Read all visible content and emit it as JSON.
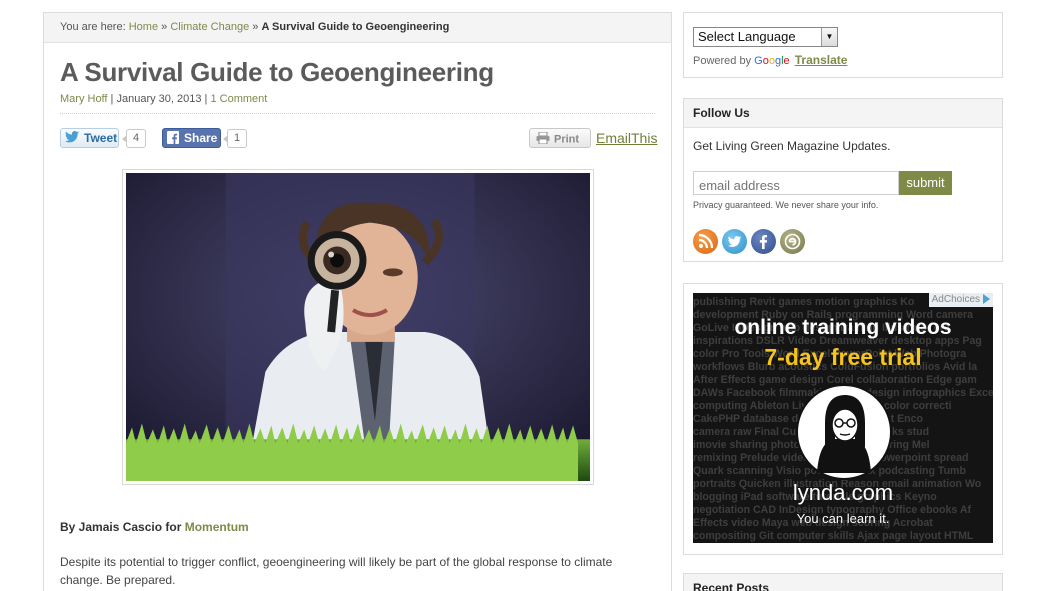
{
  "breadcrumb": {
    "prefix": "You are here:",
    "home": "Home",
    "category": "Climate Change",
    "current": "A Survival Guide to Geoengineering",
    "separator": "»"
  },
  "article": {
    "title": "A Survival Guide to Geoengineering",
    "author": "Mary Hoff",
    "date": "January 30, 2013",
    "comments": "1 Comment",
    "byline_prefix": "By Jamais Cascio for",
    "byline_source": "Momentum",
    "paragraph": "Despite its potential to trigger conflict, geoengineering will likely be part of the global response to climate change. Be prepared."
  },
  "share": {
    "tweet_label": "Tweet",
    "tweet_count": "4",
    "share_label": "Share",
    "share_count": "1",
    "print_label": "Print",
    "email_label": "EmailThis"
  },
  "sidebar": {
    "language": {
      "select_value": "Select Language",
      "powered_by": "Powered by",
      "google": [
        "G",
        "o",
        "o",
        "g",
        "l",
        "e"
      ],
      "translate": "Translate"
    },
    "follow": {
      "heading": "Follow Us",
      "description": "Get Living Green Magazine Updates.",
      "email_placeholder": "email address",
      "submit_label": "submit",
      "privacy": "Privacy guaranteed. We never share your info.",
      "social_icons": [
        "rss-icon",
        "twitter-icon",
        "facebook-icon",
        "ezine-icon"
      ]
    },
    "ad": {
      "adchoices": "AdChoices",
      "headline": "online training videos",
      "offer": "7-day free trial",
      "brand": "lynda.com",
      "tagline": "You can learn it.",
      "wall_lines": [
        "publishing Revit games motion graphics Ko",
        "development Ruby on Rails programming Word camera",
        "GoLive InDesign web design training Illustrator cre",
        "inspirations DSLR Video Dreamweaver desktop apps Pag",
        "color Pro Tools Word Excel PowerPoint Web Photogra",
        "workflows Blurb acoustics ColdFusion portfolios Avid la",
        "After Effects game design Corel collaboration Edge gam",
        "DAWs Facebook filmmaking flash design infographics Excel r",
        "computing Ableton Live audio Bridge color correcti",
        "CakePHP database design development Enco",
        "camera raw Final Cut Pro Flash Fireworks stud",
        "imovie sharing photography and rendering Mel",
        "remixing Prelude video typography Powerpoint spread",
        "Quark scanning Visio podcasts Ajax podcasting Tumb",
        "portraits Quicken illustration Reason email animation Wo",
        "blogging iPad software tutorials graphics Keyno",
        "negotiation CAD InDesign typography Office ebooks Af",
        "Effects video Maya web design scoring Acrobat",
        "compositing Git computer skills Ajax page layout HTML"
      ]
    },
    "recent": {
      "heading": "Recent Posts"
    }
  },
  "colors": {
    "link_olive": "#7d8a4a",
    "submit_bg": "#7f8a47",
    "ad_yellow": "#f7c41c"
  }
}
